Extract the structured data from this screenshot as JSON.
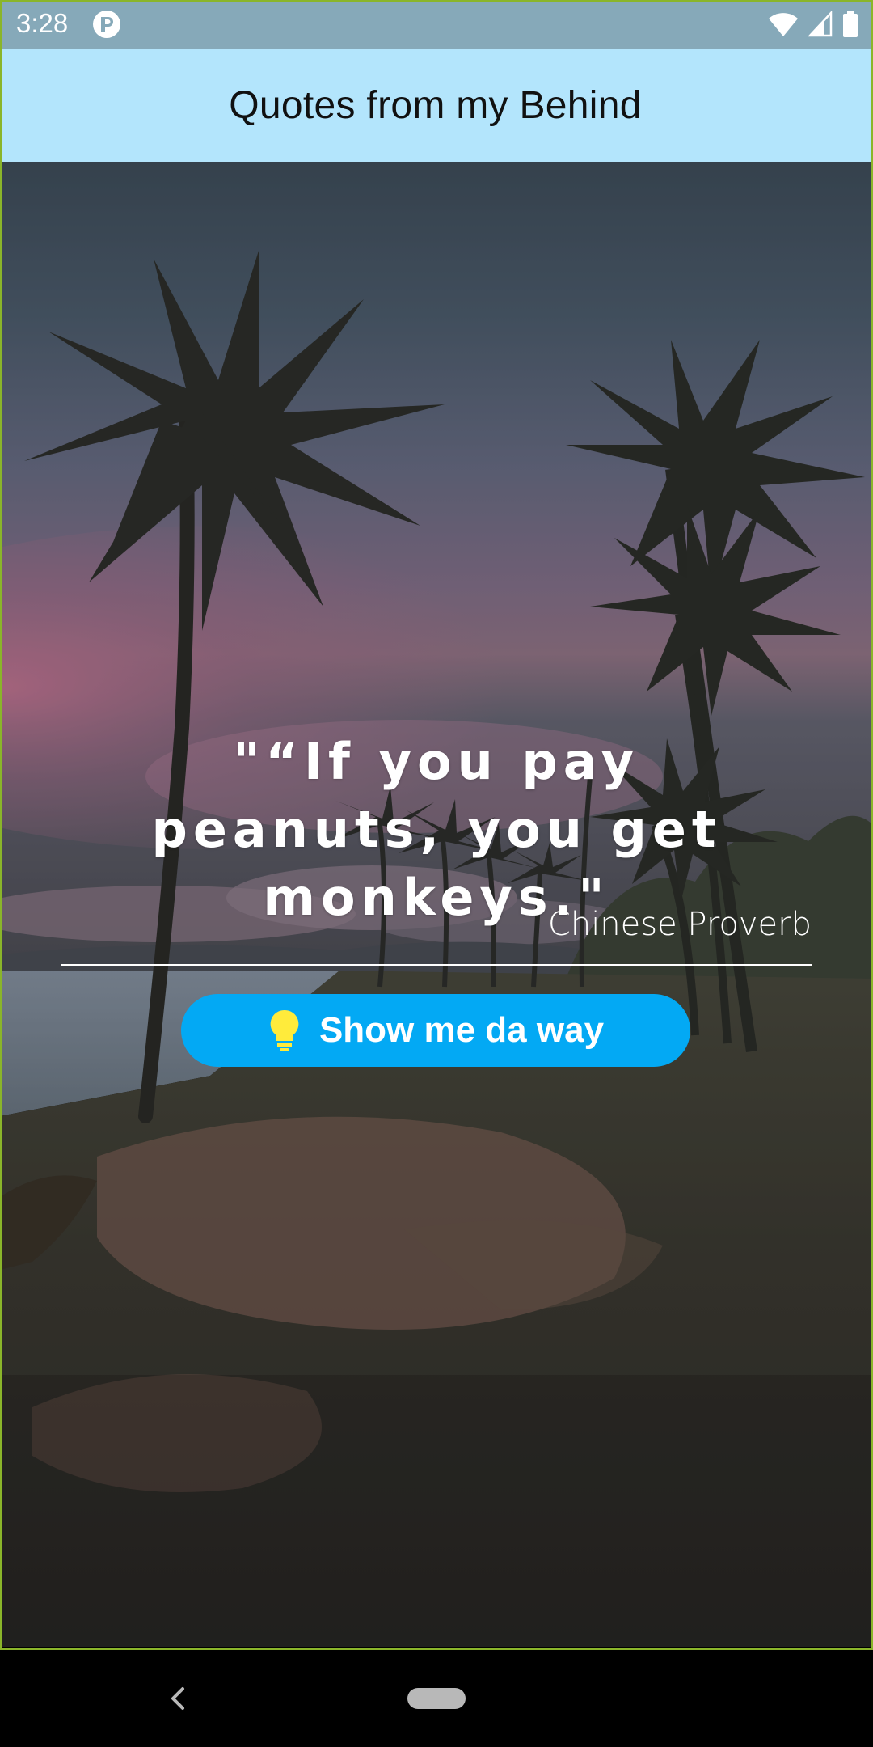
{
  "status_bar": {
    "time": "3:28",
    "app_icon": "app-notification-icon",
    "icons": [
      "wifi-icon",
      "signal-icon",
      "battery-icon"
    ]
  },
  "app_bar": {
    "title": "Quotes from my Behind"
  },
  "quote": {
    "text": "\"“If you pay peanuts, you get monkeys.\"",
    "author": "Chinese Proverb"
  },
  "action_button": {
    "label": "Show me da way",
    "icon": "lightbulb-icon"
  },
  "navigation": {
    "back_icon": "back-icon",
    "home_icon": "home-pill-icon"
  },
  "colors": {
    "status_bar": "#86a9b9",
    "app_bar": "#b3e5fc",
    "button": "#03a9f4",
    "bulb": "#ffeb3b"
  }
}
